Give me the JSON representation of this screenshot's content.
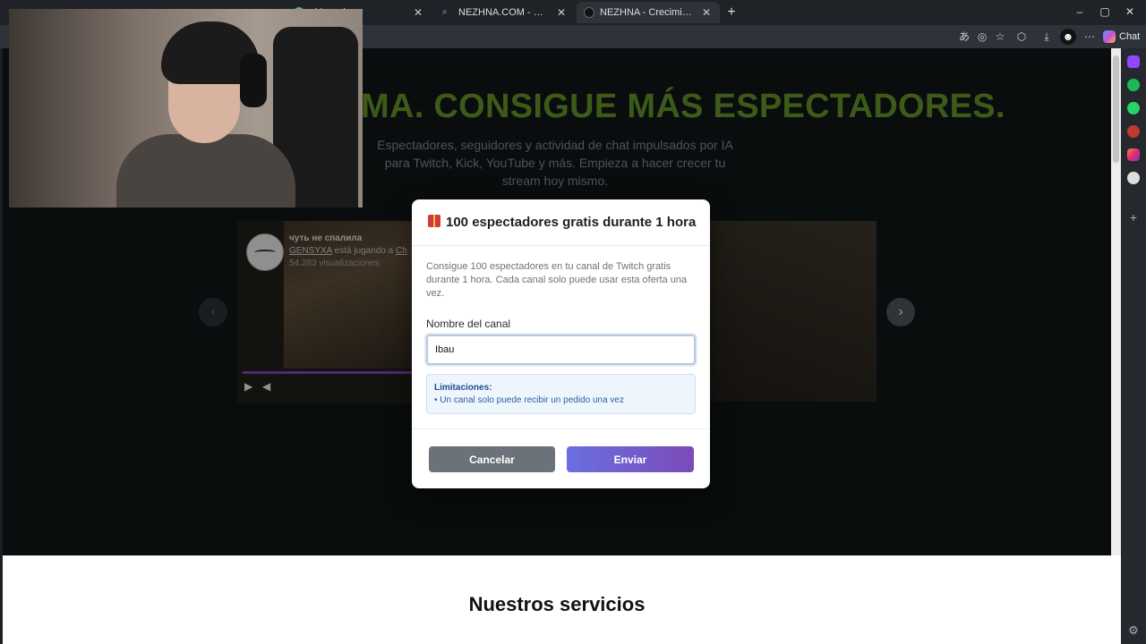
{
  "browser": {
    "tabs": [
      {
        "title": "shboard",
        "active": false
      },
      {
        "title": "NEZHNA.COM - Búsqueda",
        "active": false
      },
      {
        "title": "NEZHNA - Crecimiento en directo",
        "active": true
      }
    ],
    "new_tab": "+",
    "window_controls": {
      "minimize": "–",
      "maximize": "▢",
      "close": "✕"
    },
    "toolbar": {
      "chat_label": "Chat"
    }
  },
  "hero": {
    "headline": "MA. CONSIGUE MÁS ESPECTADORES.",
    "subtitle": "Espectadores, seguidores y actividad de chat impulsados por IA para Twitch, Kick, YouTube y más. Empieza a hacer crecer tu stream hoy mismo.",
    "prev_icon": "‹",
    "next_icon": "›",
    "headline_color": "#5f8a25"
  },
  "video_card": {
    "title": "чуть не спалила",
    "channel": "GENSYXA",
    "playing_text": " está jugando a ",
    "game": "Ch",
    "views": "54.283 visualizaciones"
  },
  "services": {
    "heading": "Nuestros servicios"
  },
  "modal": {
    "title": "100 espectadores gratis durante 1 hora",
    "description": "Consigue 100 espectadores en tu canal de Twitch gratis durante 1 hora. Cada canal solo puede usar esta oferta una vez.",
    "field_label": "Nombre del canal",
    "field_value": "Ibau",
    "limits_title": "Limitaciones:",
    "limits_item": "• Un canal solo puede recibir un pedido una vez",
    "cancel_label": "Cancelar",
    "send_label": "Enviar",
    "accent_color": "#6a6fe0"
  }
}
